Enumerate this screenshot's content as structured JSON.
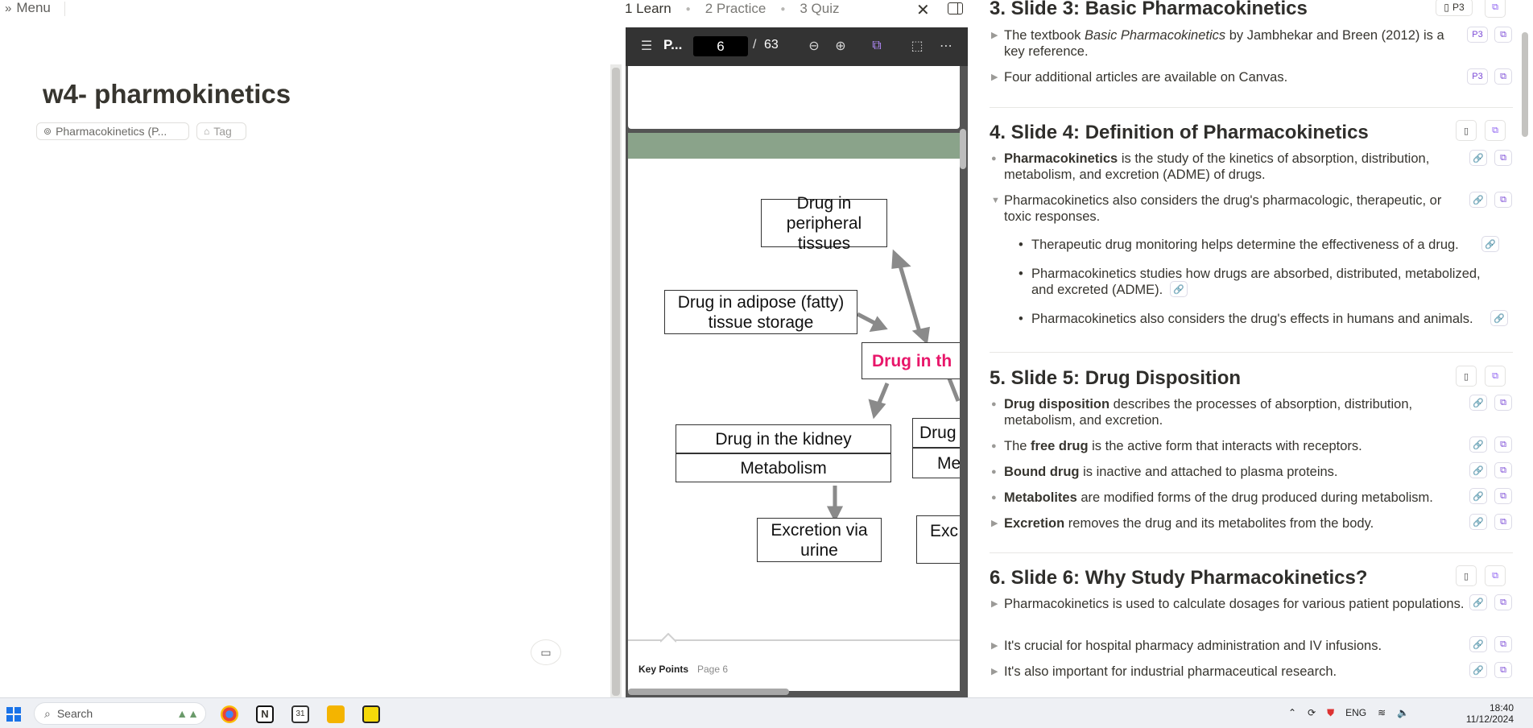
{
  "menu": {
    "label": "Menu"
  },
  "doc": {
    "title": "w4- pharmokinetics",
    "chip_label": "Pharmacokinetics (P...",
    "tag_label": "Tag"
  },
  "tabs": {
    "items": [
      "1 Learn",
      "2 Practice",
      "3 Quiz"
    ],
    "active_index": 0
  },
  "pdf": {
    "name": "P...",
    "page_current": "6",
    "page_sep": "/",
    "page_total": "63",
    "boxes": {
      "peripheral": "Drug in peripheral tissues",
      "adipose": "Drug in adipose (fatty) tissue storage",
      "center": "Drug in th",
      "kidney": "Drug in the kidney",
      "metabolism": "Metabolism",
      "urine": "Excretion via urine",
      "liver_partial": "Drug",
      "metab_partial": "Me",
      "exc_partial": "Exc"
    },
    "center_color": "#e8166a",
    "key_points_label": "Key Points",
    "key_points_page": "Page 6"
  },
  "notes": {
    "sections": [
      {
        "title": "3. Slide 3: Basic Pharmacokinetics",
        "badge": "P3",
        "bullets": [
          {
            "pre": "The textbook ",
            "em": "Basic Pharmacokinetics",
            "post": " by Jambhekar and Breen (2012) is a key reference.",
            "badge": "P3"
          },
          {
            "pre": "Four additional articles are available on Canvas.",
            "badge": "P3"
          }
        ]
      },
      {
        "title": "4. Slide 4: Definition of Pharmacokinetics",
        "bullets": [
          {
            "bold": "Pharmacokinetics",
            "post": " is the study of the kinetics of absorption, distribution, metabolism, and excretion (ADME) of drugs."
          },
          {
            "pre": "Pharmacokinetics also considers the drug's pharmacologic, therapeutic, or toxic responses."
          }
        ],
        "subs": [
          "Therapeutic drug monitoring helps determine the effectiveness of a drug.",
          "Pharmacokinetics studies how drugs are absorbed, distributed, metabolized, and excreted (ADME).",
          "Pharmacokinetics also considers the drug's effects in humans and animals."
        ]
      },
      {
        "title": "5. Slide 5: Drug Disposition",
        "bullets": [
          {
            "bold": "Drug disposition",
            "post": " describes the processes of absorption, distribution, metabolism, and excretion."
          },
          {
            "pre": "The ",
            "bold": "free drug",
            "post": " is the active form that interacts with receptors."
          },
          {
            "bold": "Bound drug",
            "post": " is inactive and attached to plasma proteins."
          },
          {
            "bold": "Metabolites",
            "post": " are modified forms of the drug produced during metabolism."
          },
          {
            "bold": "Excretion",
            "post": " removes the drug and its metabolites from the body."
          }
        ]
      },
      {
        "title": "6. Slide 6: Why Study Pharmacokinetics?",
        "bullets": [
          {
            "pre": "Pharmacokinetics is used to calculate dosages for various patient populations."
          },
          {
            "pre": "It's crucial for hospital pharmacy administration and IV infusions."
          },
          {
            "pre": "It's also important for industrial pharmaceutical research."
          }
        ]
      }
    ]
  },
  "taskbar": {
    "search_label": "Search",
    "lang": "ENG",
    "time": "18:40",
    "date": "11/12/2024"
  },
  "colors": {
    "accent": "#7a48d6",
    "pdf_toolbar": "#333333",
    "pdf_bg": "#545454"
  }
}
